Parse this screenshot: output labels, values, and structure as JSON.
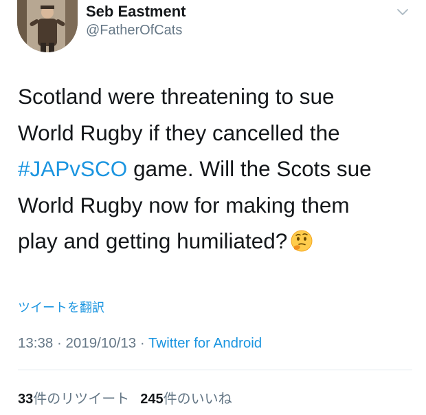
{
  "author": {
    "display_name": "Seb Eastment",
    "handle": "@FatherOfCats"
  },
  "tweet": {
    "lines": [
      "Scotland were threatening to sue",
      "World Rugby if they cancelled the",
      " game. Will the Scots sue",
      "World Rugby now for making them",
      "play and getting humiliated?"
    ],
    "hashtag": "#JAPvSCO",
    "emoji_icon": "thinking-face-emoji"
  },
  "translate_label": "ツイートを翻訳",
  "meta": {
    "time": "13:38",
    "separator1": " · ",
    "date": "2019/10/13",
    "separator2": " · ",
    "source": "Twitter for Android"
  },
  "stats": {
    "retweet_count": "33",
    "retweet_label": "件のリツイート",
    "like_count": "245",
    "like_label": "件のいいね"
  },
  "colors": {
    "link": "#1b95e0",
    "secondary": "#657786",
    "text": "#14171a"
  }
}
